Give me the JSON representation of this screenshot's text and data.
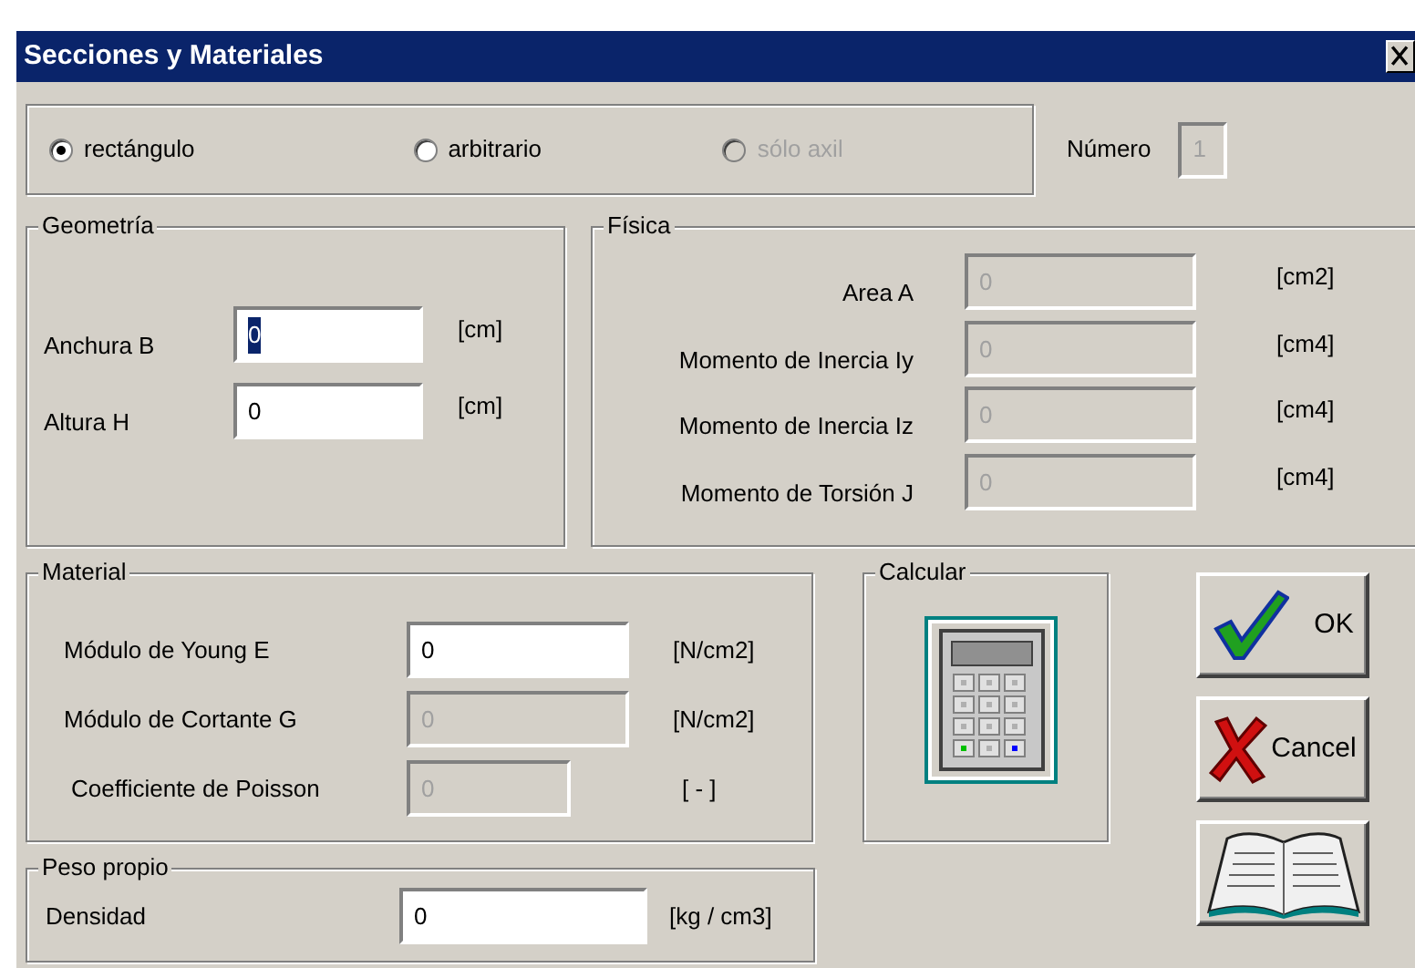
{
  "window": {
    "title": "Secciones y Materiales"
  },
  "section_type": [
    {
      "label": "rectángulo",
      "selected": true,
      "disabled": false
    },
    {
      "label": "arbitrario",
      "selected": false,
      "disabled": false
    },
    {
      "label": "sólo axil",
      "selected": false,
      "disabled": true
    }
  ],
  "numero": {
    "label": "Número",
    "value": "1",
    "disabled": true
  },
  "geometria": {
    "title": "Geometría",
    "rows": [
      {
        "label": "Anchura B",
        "value": "0",
        "unit": "[cm]",
        "disabled": false,
        "focused": true
      },
      {
        "label": "Altura H",
        "value": "0",
        "unit": "[cm]",
        "disabled": false,
        "focused": false
      }
    ]
  },
  "fisica": {
    "title": "Física",
    "rows": [
      {
        "label": "Area A",
        "value": "0",
        "unit": "[cm2]",
        "disabled": true
      },
      {
        "label": "Momento de Inercia  Iy",
        "value": "0",
        "unit": "[cm4]",
        "disabled": true
      },
      {
        "label": "Momento de Inercia  Iz",
        "value": "0",
        "unit": "[cm4]",
        "disabled": true
      },
      {
        "label": "Momento de Torsión J",
        "value": "0",
        "unit": "[cm4]",
        "disabled": true
      }
    ]
  },
  "material": {
    "title": "Material",
    "rows": [
      {
        "label": "Módulo de Young  E",
        "value": "0",
        "unit": "[N/cm2]",
        "disabled": false
      },
      {
        "label": "Módulo de Cortante  G",
        "value": "0",
        "unit": "[N/cm2]",
        "disabled": true
      },
      {
        "label": "Coefficiente de Poisson",
        "value": "0",
        "unit": "[ - ]",
        "disabled": true
      }
    ]
  },
  "peso_propio": {
    "title": "Peso propio",
    "rows": [
      {
        "label": "Densidad",
        "value": "0",
        "unit": "[kg / cm3]",
        "disabled": false
      }
    ]
  },
  "calcular": {
    "title": "Calcular"
  },
  "buttons": [
    {
      "kind": "ok",
      "label": "OK"
    },
    {
      "kind": "cancel",
      "label": "Cancel"
    },
    {
      "kind": "help"
    }
  ]
}
